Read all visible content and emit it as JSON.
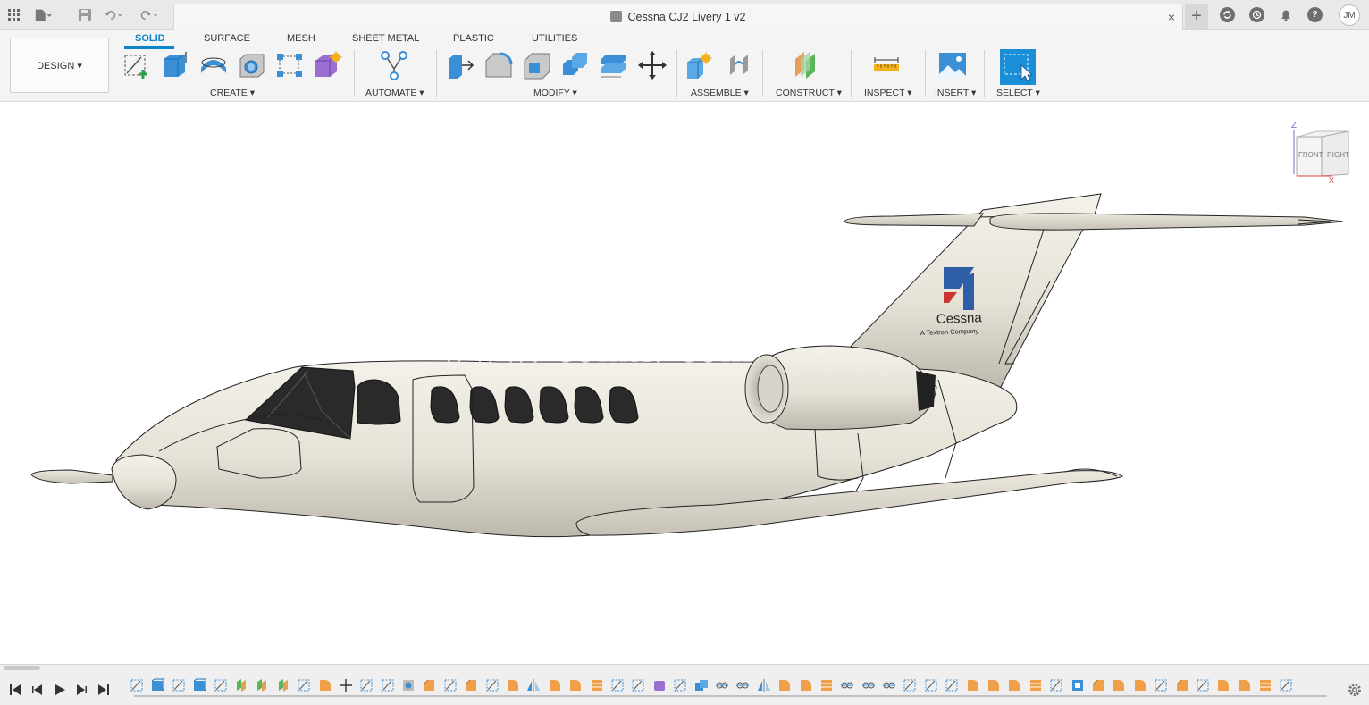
{
  "titlebar": {
    "document_title": "Cessna CJ2 Livery 1 v2",
    "close_glyph": "×",
    "new_tab_glyph": "+",
    "user_initials": "JM",
    "icons": [
      "grid-icon",
      "file-icon",
      "save-icon",
      "undo-icon",
      "redo-icon",
      "sync-icon",
      "history-icon",
      "notifications-icon",
      "help-icon"
    ]
  },
  "toolbar": {
    "workspace": "DESIGN ▾",
    "tabs": [
      {
        "label": "SOLID",
        "active": true
      },
      {
        "label": "SURFACE",
        "active": false
      },
      {
        "label": "MESH",
        "active": false
      },
      {
        "label": "SHEET METAL",
        "active": false
      },
      {
        "label": "PLASTIC",
        "active": false
      },
      {
        "label": "UTILITIES",
        "active": false
      }
    ],
    "groups": {
      "create": "CREATE ▾",
      "automate": "AUTOMATE ▾",
      "modify": "MODIFY ▾",
      "assemble": "ASSEMBLE ▾",
      "construct": "CONSTRUCT ▾",
      "inspect": "INSPECT ▾",
      "insert": "INSERT ▾",
      "select": "SELECT ▾"
    }
  },
  "viewport": {
    "viewcube": {
      "front": "FRONT",
      "right": "RIGHT",
      "axis_z": "Z",
      "axis_x": "X"
    },
    "livery": {
      "brand": "Cessna",
      "tagline": "A Textron Company"
    },
    "watermark": "www. comx. com"
  },
  "timeline": {
    "controls": [
      "skip-to-start",
      "step-back",
      "play",
      "step-forward",
      "skip-to-end"
    ],
    "feature_count": 56
  },
  "colors": {
    "accent": "#0d83c9",
    "fuselage": "#e8e4da",
    "window": "#2a2a2a",
    "logo_blue": "#2e5ea8",
    "logo_red": "#c7362f"
  }
}
